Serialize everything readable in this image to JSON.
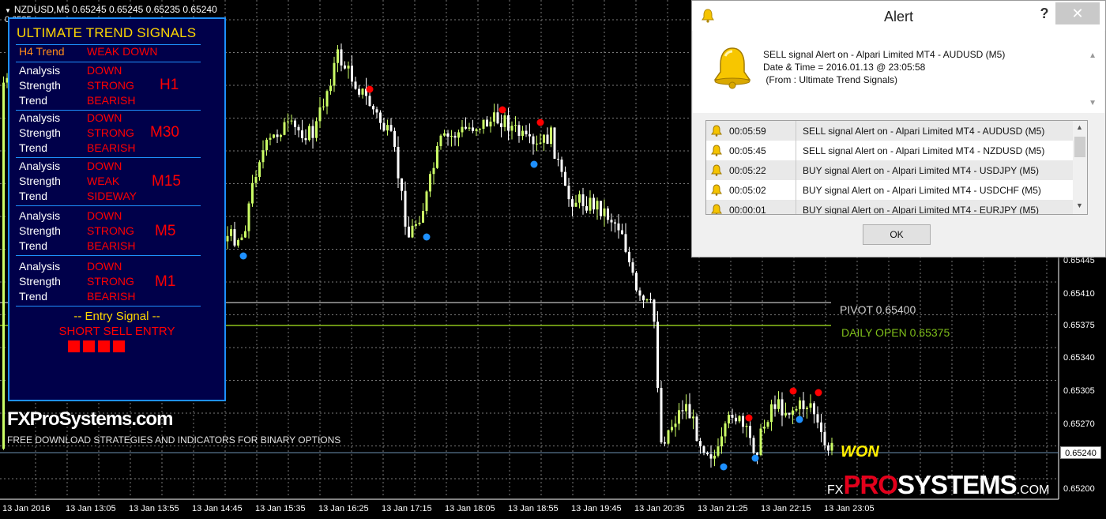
{
  "chart": {
    "symbol_line": "NZDUSD,M5  0.65245 0.65245 0.65235 0.65240",
    "top_price": "0.6585",
    "current_price": "0.65240",
    "price_axis": [
      "0.65445",
      "0.65410",
      "0.65375",
      "0.65340",
      "0.65305",
      "0.65270",
      "0.65235",
      "0.65200"
    ],
    "time_axis": [
      "13 Jan 2016",
      "13 Jan 13:05",
      "13 Jan 13:55",
      "13 Jan 14:45",
      "13 Jan 15:35",
      "13 Jan 16:25",
      "13 Jan 17:15",
      "13 Jan 18:05",
      "13 Jan 18:55",
      "13 Jan 19:45",
      "13 Jan 20:35",
      "13 Jan 21:25",
      "13 Jan 22:15",
      "13 Jan 23:05"
    ],
    "pivot_label": "PIVOT 0.65400",
    "daily_open_label": "DAILY OPEN 0.65375",
    "won_label": "WON",
    "colors": {
      "bull": "#ccff66",
      "bear": "#ffffff",
      "pivot": "#a0a0a0",
      "daily_open": "#8ec21a",
      "sell_dot": "#ff0000",
      "buy_dot": "#1e90ff"
    }
  },
  "panel": {
    "title": "ULTIMATE TREND SIGNALS",
    "h4_label": "H4 Trend",
    "h4_value": "WEAK DOWN",
    "groups": [
      {
        "tf": "H1",
        "rows": [
          {
            "label": "Analysis",
            "value": "DOWN"
          },
          {
            "label": "Strength",
            "value": "STRONG"
          },
          {
            "label": "Trend",
            "value": "BEARISH"
          }
        ]
      },
      {
        "tf": "M30",
        "rows": [
          {
            "label": "Analysis",
            "value": "DOWN"
          },
          {
            "label": "Strength",
            "value": "STRONG"
          },
          {
            "label": "Trend",
            "value": "BEARISH"
          }
        ]
      },
      {
        "tf": "M15",
        "rows": [
          {
            "label": "Analysis",
            "value": "DOWN"
          },
          {
            "label": "Strength",
            "value": "WEAK"
          },
          {
            "label": "Trend",
            "value": "SIDEWAY"
          }
        ]
      },
      {
        "tf": "M5",
        "rows": [
          {
            "label": "Analysis",
            "value": "DOWN"
          },
          {
            "label": "Strength",
            "value": "STRONG"
          },
          {
            "label": "Trend",
            "value": "BEARISH"
          }
        ]
      },
      {
        "tf": "M1",
        "rows": [
          {
            "label": "Analysis",
            "value": "DOWN"
          },
          {
            "label": "Strength",
            "value": "STRONG"
          },
          {
            "label": "Trend",
            "value": "BEARISH"
          }
        ]
      }
    ],
    "entry_title": "--  Entry Signal  --",
    "entry_text": "SHORT SELL ENTRY"
  },
  "branding": {
    "site": "FXProSystems.com",
    "tagline": "FREE DOWNLOAD STRATEGIES AND INDICATORS FOR BINARY OPTIONS",
    "logo_fx": "FX",
    "logo_pro": "PRO",
    "logo_systems": "SYSTEMS",
    "logo_com": ".COM"
  },
  "alert": {
    "title": "Alert",
    "help": "?",
    "close": "✕",
    "message_line1": "SELL signal Alert on - Alpari Limited MT4 - AUDUSD (M5)",
    "message_line2": "Date & Time = 2016.01.13 @ 23:05:58",
    "message_line3": " (From : Ultimate Trend Signals)",
    "rows": [
      {
        "time": "00:05:59",
        "message": "SELL signal Alert on - Alpari Limited MT4 - AUDUSD (M5)"
      },
      {
        "time": "00:05:45",
        "message": "SELL signal Alert on - Alpari Limited MT4 - NZDUSD (M5)"
      },
      {
        "time": "00:05:22",
        "message": "BUY signal Alert on - Alpari Limited MT4 - USDJPY (M5)"
      },
      {
        "time": "00:05:02",
        "message": "BUY signal Alert on - Alpari Limited MT4 - USDCHF (M5)"
      },
      {
        "time": "00:00:01",
        "message": "BUY signal Alert on - Alpari Limited MT4 - EURJPY (M5)"
      }
    ],
    "ok_label": "OK"
  }
}
